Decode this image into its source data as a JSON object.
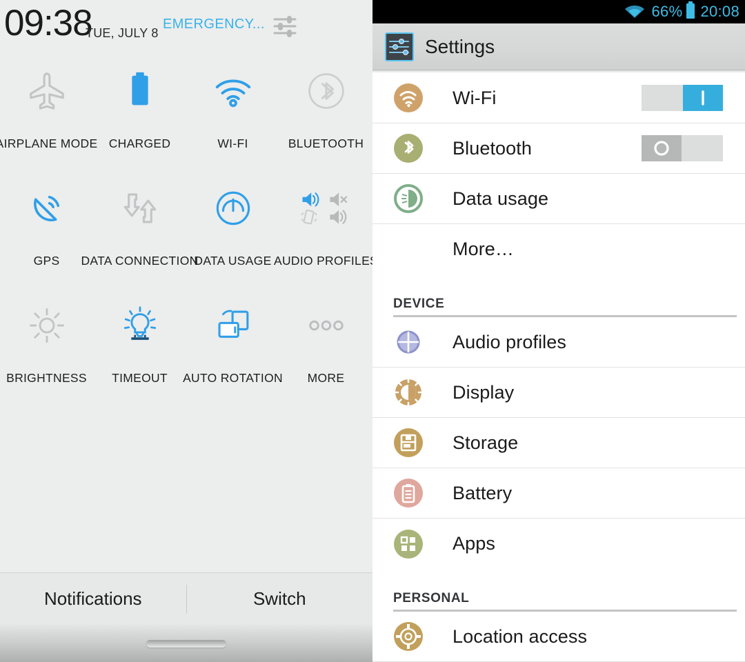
{
  "quick_settings": {
    "clock": "09:38",
    "date": "TUE, JULY 8",
    "emergency_label": "EMERGENCY...",
    "settings_icon": "sliders-icon",
    "tiles": [
      [
        {
          "label": "AIRPLANE MODE",
          "icon": "airplane-icon",
          "state": "off"
        },
        {
          "label": "CHARGED",
          "icon": "battery-icon",
          "state": "on"
        },
        {
          "label": "WI-FI",
          "icon": "wifi-icon",
          "state": "on"
        },
        {
          "label": "BLUETOOTH",
          "icon": "bluetooth-icon",
          "state": "off"
        }
      ],
      [
        {
          "label": "GPS",
          "icon": "gps-satellite-icon",
          "state": "on"
        },
        {
          "label": "DATA CONNECTION",
          "icon": "data-sync-arrows-icon",
          "state": "off"
        },
        {
          "label": "DATA USAGE",
          "icon": "speedometer-icon",
          "state": "on"
        },
        {
          "label": "AUDIO PROFILES",
          "icon": "audio-profiles-grid-icon",
          "state": "on"
        }
      ],
      [
        {
          "label": "BRIGHTNESS",
          "icon": "sun-icon",
          "state": "off"
        },
        {
          "label": "TIMEOUT",
          "icon": "lightbulb-icon",
          "state": "on"
        },
        {
          "label": "AUTO ROTATION",
          "icon": "auto-rotate-icon",
          "state": "on"
        },
        {
          "label": "MORE",
          "icon": "three-dots-icon",
          "state": "off"
        }
      ]
    ],
    "footer": {
      "notifications_label": "Notifications",
      "switch_label": "Switch"
    },
    "colors": {
      "accent_blue": "#38a1e8",
      "inactive_gray": "#c0c1c2",
      "panel_bg": "#eceded",
      "emergency_blue": "#38b3e8"
    }
  },
  "settings_app": {
    "statusbar": {
      "wifi_icon": "wifi-icon",
      "battery_percent": "66%",
      "battery_icon": "battery-icon",
      "clock": "20:08",
      "text_color": "#3fbce6",
      "bg_color": "#000000"
    },
    "header": {
      "icon": "settings-sliders-icon",
      "title": "Settings"
    },
    "items": [
      {
        "label": "Wi-Fi",
        "icon": "wifi-icon",
        "icon_color": "#cfa26a",
        "toggle": "on"
      },
      {
        "label": "Bluetooth",
        "icon": "bluetooth-icon",
        "icon_color": "#a9ae72",
        "toggle": "off"
      },
      {
        "label": "Data usage",
        "icon": "data-usage-pie-icon",
        "icon_color": "#7fae89",
        "toggle": "none"
      },
      {
        "label": "More…",
        "icon": "none",
        "icon_color": "",
        "toggle": "none"
      }
    ],
    "sections": [
      {
        "title": "DEVICE",
        "items": [
          {
            "label": "Audio profiles",
            "icon": "audio-profiles-crosshair-icon",
            "icon_color": "#9295ce"
          },
          {
            "label": "Display",
            "icon": "display-sun-icon",
            "icon_color": "#c9a167"
          },
          {
            "label": "Storage",
            "icon": "storage-icon",
            "icon_color": "#c2a05c"
          },
          {
            "label": "Battery",
            "icon": "battery-icon",
            "icon_color": "#dfa79d"
          },
          {
            "label": "Apps",
            "icon": "apps-grid-icon",
            "icon_color": "#a8b479"
          }
        ]
      },
      {
        "title": "PERSONAL",
        "items": [
          {
            "label": "Location access",
            "icon": "location-target-icon",
            "icon_color": "#c2a05c"
          }
        ]
      }
    ],
    "toggle_colors": {
      "on": "#36aedd",
      "off_track": "#d9dada",
      "off_thumb": "#b6b7b7"
    }
  }
}
